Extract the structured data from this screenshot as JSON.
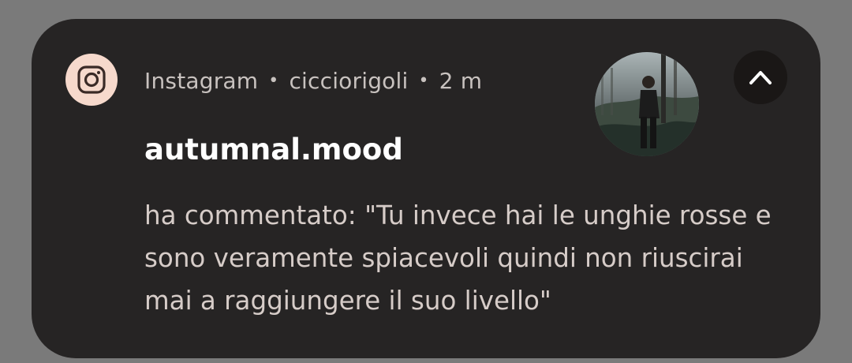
{
  "notification": {
    "app_name": "Instagram",
    "separator": "•",
    "account": "cicciorigoli",
    "time": "2 m",
    "title": "autumnal.mood",
    "message": "ha commentato: \"Tu invece hai le unghie rosse e sono veramente spiacevoli quindi non riuscirai mai a raggiungere il suo livello\"",
    "app_icon": "instagram-icon",
    "collapse_icon": "chevron-up-icon",
    "colors": {
      "background": "#7a7a7a",
      "card": "#262424",
      "app_icon_bg": "#f6d9cc",
      "title": "#ffffff",
      "text": "#d6ccc8"
    }
  }
}
